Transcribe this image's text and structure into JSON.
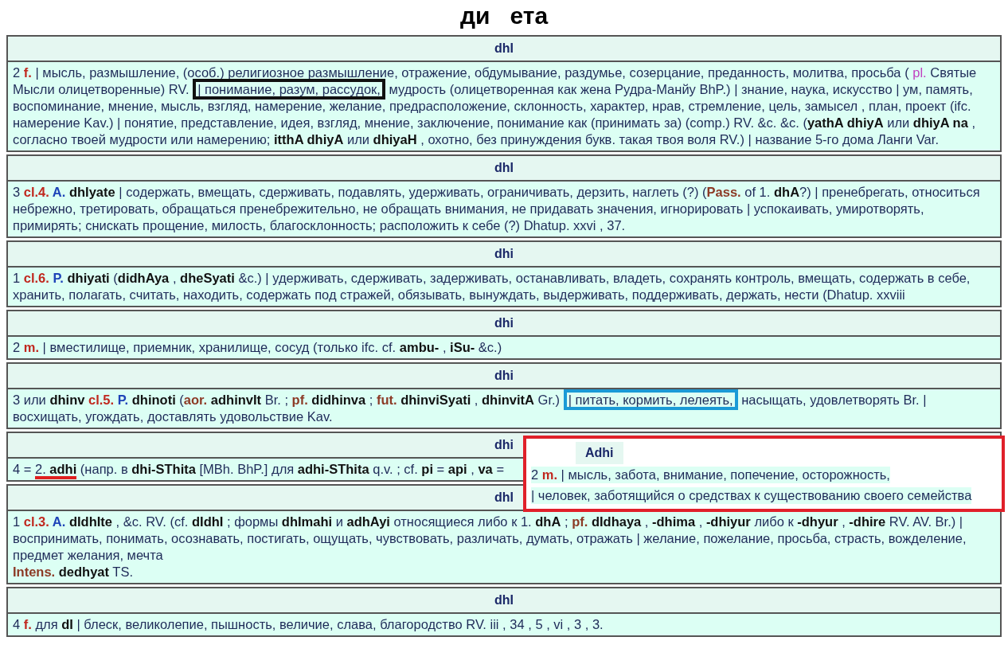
{
  "title": "ди   ета",
  "entries": [
    {
      "head": "dhI",
      "paragraphs": [
        [
          {
            "kind": "t",
            "text": "2 "
          },
          {
            "kind": "g",
            "text": "f."
          },
          {
            "kind": "t",
            "text": " | мысль, размышление, (особ.) религиозное размышление, отражение, обдумывание, раздумье, созерцание, преданность, молитва, просьба ( "
          },
          {
            "kind": "p",
            "text": "pl."
          },
          {
            "kind": "t",
            "text": " Святые Мысли олицетворенные) RV. "
          },
          {
            "kind": "boxed",
            "color": "#111111",
            "text": "| понимание, разум, рассудок,"
          },
          {
            "kind": "t",
            "text": " мудрость (олицетворенная как жена Рудра-Манйу BhP.) | знание, наука, искусство | ум, память, воспоминание, мнение, мысль, взгляд, намерение, желание, предрасположение, склонность, характер, нрав, стремление, цель, замысел , план, проект (ifc. намерение Kav.) | понятие, представление, идея, взгляд, мнение, заключение, понимание как (принимать за) (comp.) RV. &c. &c. (**yathA dhiyA** или **dhiyA na** , согласно твоей мудрости или намерению; **itthA dhiyA** или **dhiyaH** , охотно, без принуждения букв. такая твоя воля RV.) | название 5-го дома Ланги Var."
          }
        ]
      ]
    },
    {
      "head": "dhI",
      "paragraphs": [
        [
          {
            "kind": "t",
            "text": "3 "
          },
          {
            "kind": "g",
            "text": "cl.4. "
          },
          {
            "kind": "v",
            "text": "A."
          },
          {
            "kind": "t",
            "text": " **dhIyate** | содержать, вмещать, сдерживать, подавлять, удерживать, ограничивать, дерзить, наглеть (?) ("
          },
          {
            "kind": "x",
            "text": "Pass."
          },
          {
            "kind": "t",
            "text": " of 1. **dhA**?) | пренебрегать, относиться небрежно, третировать, обращаться пренебрежительно, не обращать внимания, не придавать значения, игнорировать | успокаивать, умиротворять, примирять; снискать прощение, милость, благосклонность; расположить к себе (?) Dhatup. xxvi , 37."
          }
        ]
      ]
    },
    {
      "head": "dhi",
      "paragraphs": [
        [
          {
            "kind": "t",
            "text": "1 "
          },
          {
            "kind": "g",
            "text": "cl.6. "
          },
          {
            "kind": "v",
            "text": "P."
          },
          {
            "kind": "t",
            "text": " **dhiyati** (**didhAya** , **dheSyati** &c.) | удерживать, сдерживать, задерживать, останавливать, владеть, сохранять контроль, вмещать, содержать в себе, хранить, полагать, считать, находить, содержать под стражей, обязывать, вынуждать, выдерживать, поддерживать, держать, нести (Dhatup. xxviii"
          }
        ]
      ]
    },
    {
      "head": "dhi",
      "paragraphs": [
        [
          {
            "kind": "t",
            "text": "2 "
          },
          {
            "kind": "g",
            "text": "m."
          },
          {
            "kind": "t",
            "text": " | вместилище, приемник, хранилище, сосуд (только ifc. cf. **ambu-** , **iSu-** &c.)"
          }
        ]
      ]
    },
    {
      "head": "dhi",
      "paragraphs": [
        [
          {
            "kind": "t",
            "text": "3 или **dhinv** "
          },
          {
            "kind": "g",
            "text": "cl.5. "
          },
          {
            "kind": "v",
            "text": "P."
          },
          {
            "kind": "t",
            "text": " **dhinoti** ("
          },
          {
            "kind": "x",
            "text": "aor."
          },
          {
            "kind": "t",
            "text": " **adhinvIt** Br. ; "
          },
          {
            "kind": "x",
            "text": "pf."
          },
          {
            "kind": "t",
            "text": " **didhinva** ; "
          },
          {
            "kind": "x",
            "text": "fut."
          },
          {
            "kind": "t",
            "text": " **dhinviSyati** , **dhinvitA** Gr.) "
          },
          {
            "kind": "boxed",
            "color": "#1a9ad6",
            "text": "| питать, кормить, лелеять,"
          },
          {
            "kind": "t",
            "text": " насыщать, удовлетворять Br. | восхищать, угождать, доставлять удовольствие Kav."
          }
        ]
      ]
    },
    {
      "head": "dhi",
      "paragraphs": [
        [
          {
            "kind": "t",
            "text": "4 = "
          },
          {
            "kind": "underlined",
            "color": "#e02020",
            "text": "2. **adhi**"
          },
          {
            "kind": "t",
            "text": " (напр. в **dhi-SThita** [MBh. BhP.] для **adhi-SThita** q.v. ; cf. **pi** = **api** , **va** ="
          }
        ]
      ],
      "popup": {
        "color": "#e0202a",
        "head": "Adhi",
        "paragraphs": [
          [
            {
              "kind": "t",
              "text": "2 "
            },
            {
              "kind": "g",
              "text": "m."
            },
            {
              "kind": "t",
              "text": " | мысль, забота, внимание, попечение, осторожность,"
            }
          ],
          [
            {
              "kind": "t",
              "text": "| человек,  заботящийся о средствах к существованию своего семейства"
            }
          ]
        ]
      }
    },
    {
      "head": "dhI",
      "paragraphs": [
        [
          {
            "kind": "t",
            "text": "1 "
          },
          {
            "kind": "g",
            "text": "cl.3. "
          },
          {
            "kind": "v",
            "text": "A."
          },
          {
            "kind": "t",
            "text": " **dIdhIte** , &c. RV. (cf. **dIdhI** ; формы **dhImahi** и **adhAyi** относящиеся либо к 1. **dhA** ; "
          },
          {
            "kind": "x",
            "text": "pf."
          },
          {
            "kind": "t",
            "text": " **dIdhaya** , **-dhima** , **-dhiyur** либо к **-dhyur** , **-dhire** RV. AV. Br.) | воспринимать, понимать, осознавать, постигать, ощущать, чувствовать, различать, думать, отражать | желание, пожелание, просьба, страсть, вожделение, предмет желания, мечта"
          }
        ],
        [
          {
            "kind": "x",
            "text": "Intens."
          },
          {
            "kind": "t",
            "text": " **dedhyat** TS."
          }
        ]
      ]
    },
    {
      "head": "dhI",
      "paragraphs": [
        [
          {
            "kind": "t",
            "text": "4 "
          },
          {
            "kind": "g",
            "text": "f."
          },
          {
            "kind": "t",
            "text": " для **dI** | блеск, великолепие, пышность, величие, слава, благородство RV. iii , 34 , 5 , vi , 3 , 3."
          }
        ]
      ]
    }
  ]
}
